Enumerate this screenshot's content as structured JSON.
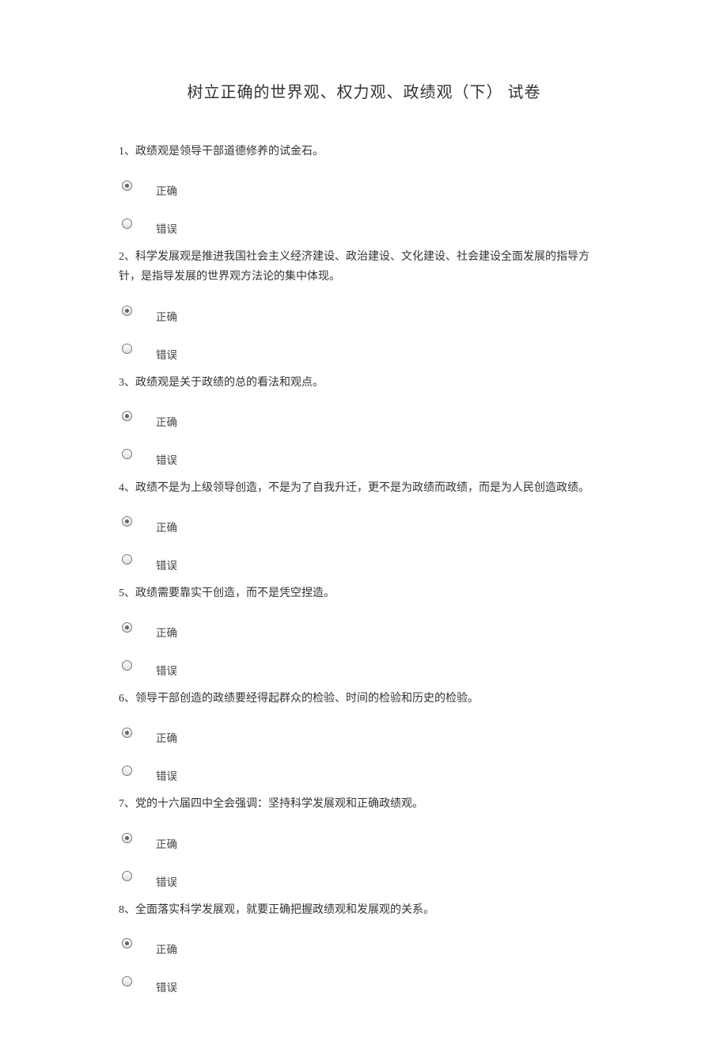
{
  "title": "树立正确的世界观、权力观、政绩观（下）   试卷",
  "option_correct": "正确",
  "option_wrong": "错误",
  "questions": [
    {
      "n": "1",
      "text": "1、政绩观是领导干部道德修养的试金石。",
      "selected": "a"
    },
    {
      "n": "2",
      "text": "2、科学发展观是推进我国社会主义经济建设、政治建设、文化建设、社会建设全面发展的指导方针，是指导发展的世界观方法论的集中体现。",
      "selected": "a"
    },
    {
      "n": "3",
      "text": "3、政绩观是关于政绩的总的看法和观点。",
      "selected": "a"
    },
    {
      "n": "4",
      "text": "4、政绩不是为上级领导创造，不是为了自我升迁，更不是为政绩而政绩，而是为人民创造政绩。",
      "selected": "a"
    },
    {
      "n": "5",
      "text": "5、政绩需要靠实干创造，而不是凭空捏造。",
      "selected": "a"
    },
    {
      "n": "6",
      "text": "6、领导干部创造的政绩要经得起群众的检验、时间的检验和历史的检验。",
      "selected": "a"
    },
    {
      "n": "7",
      "text": "7、党的十六届四中全会强调：坚持科学发展观和正确政绩观。",
      "selected": "a"
    },
    {
      "n": "8",
      "text": "8、全面落实科学发展观，就要正确把握政绩观和发展观的关系。",
      "selected": "a"
    }
  ]
}
